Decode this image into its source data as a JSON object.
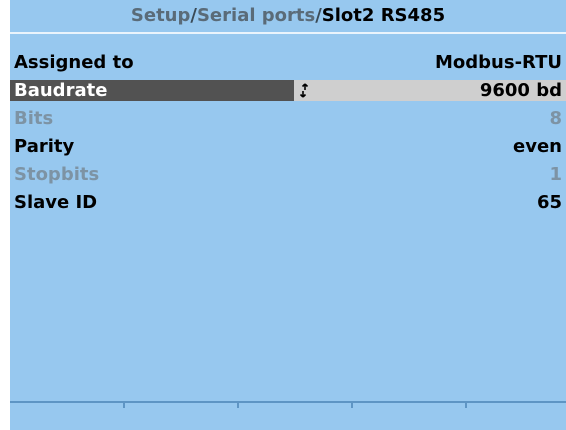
{
  "breadcrumb": {
    "part1": "Setup",
    "sep1": "/",
    "part2": "Serial ports",
    "sep2": "/",
    "current": "Slot2 RS485"
  },
  "rows": [
    {
      "label": "Assigned to",
      "value": "Modbus-RTU",
      "state": "normal"
    },
    {
      "label": "Baudrate",
      "value": "9600 bd",
      "state": "selected"
    },
    {
      "label": "Bits",
      "value": "8",
      "state": "disabled"
    },
    {
      "label": "Parity",
      "value": "even",
      "state": "normal"
    },
    {
      "label": "Stopbits",
      "value": "1",
      "state": "disabled"
    },
    {
      "label": "Slave ID",
      "value": "65",
      "state": "normal"
    }
  ],
  "icons": {
    "edit": "up-down-arrows-icon"
  },
  "colors": {
    "screen_bg": "#97c8ef",
    "selected_label_bg": "#525252",
    "selected_value_bg": "#cfcfcf",
    "disabled_text": "#7d93a4"
  }
}
